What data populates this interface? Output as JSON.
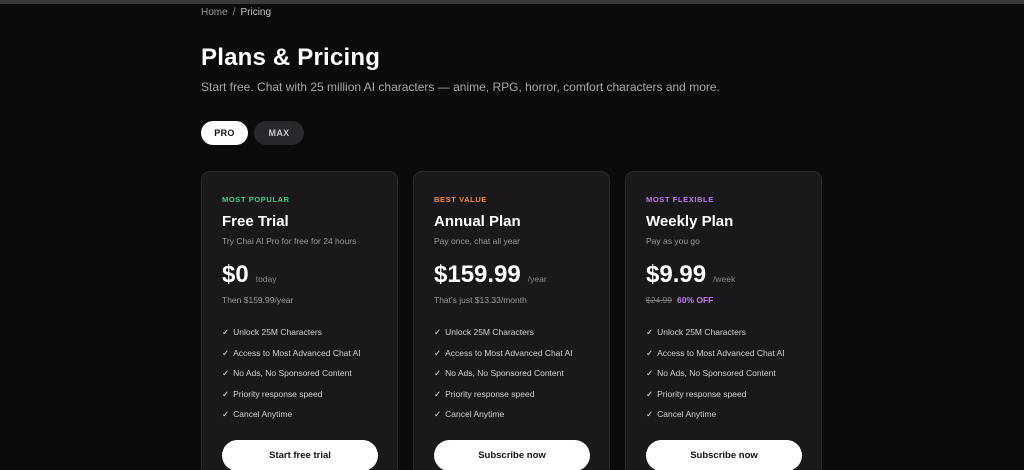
{
  "breadcrumb": {
    "home": "Home",
    "separator": "/",
    "current": "Pricing"
  },
  "header": {
    "title": "Plans & Pricing",
    "subtitle": "Start free. Chat with 25 million AI characters — anime, RPG, horror, comfort characters and more."
  },
  "toggle": {
    "options": [
      "PRO",
      "MAX"
    ],
    "selected": "PRO"
  },
  "colors": {
    "badge_green": "#35d08a",
    "badge_orange": "#f08a3c",
    "badge_purple": "#b77cf0",
    "discount": "#c07ff0"
  },
  "plans": [
    {
      "badge": "MOST POPULAR",
      "name": "Free Trial",
      "desc": "Try Chai AI Pro for free for 24 hours",
      "price": "$0",
      "period": "today",
      "note": "Then $159.99/year",
      "features": [
        "Unlock 25M Characters",
        "Access to Most Advanced Chat AI",
        "No Ads, No Sponsored Content",
        "Priority response speed",
        "Cancel Anytime"
      ],
      "cta": "Start free trial"
    },
    {
      "badge": "BEST VALUE",
      "name": "Annual Plan",
      "desc": "Pay once, chat all year",
      "price": "$159.99",
      "period": "/year",
      "note": "That's just $13.33/month",
      "features": [
        "Unlock 25M Characters",
        "Access to Most Advanced Chat AI",
        "No Ads, No Sponsored Content",
        "Priority response speed",
        "Cancel Anytime"
      ],
      "cta": "Subscribe now"
    },
    {
      "badge": "MOST FLEXIBLE",
      "name": "Weekly Plan",
      "desc": "Pay as you go",
      "price": "$9.99",
      "period": "/week",
      "old_price": "$24.99",
      "discount": "60% OFF",
      "features": [
        "Unlock 25M Characters",
        "Access to Most Advanced Chat AI",
        "No Ads, No Sponsored Content",
        "Priority response speed",
        "Cancel Anytime"
      ],
      "cta": "Subscribe now"
    }
  ],
  "check_symbol": "✓"
}
